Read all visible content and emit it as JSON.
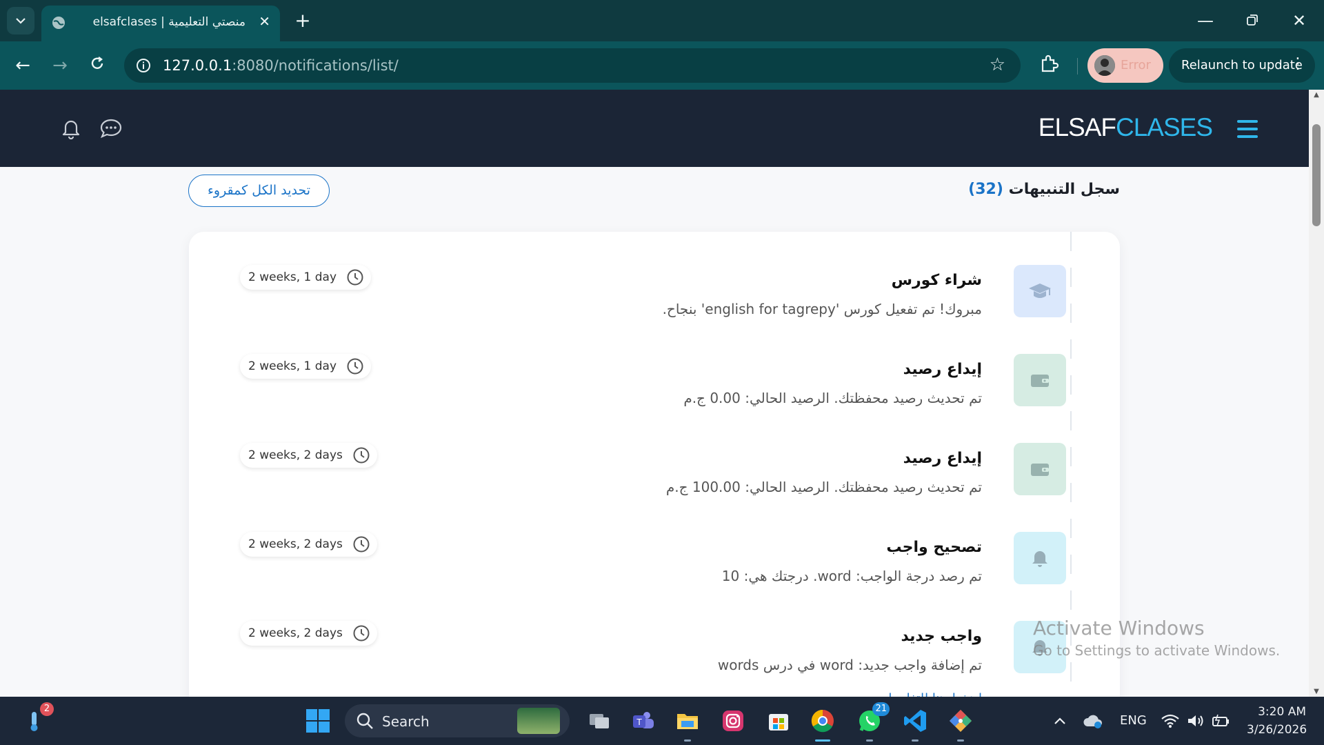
{
  "browser": {
    "tab_title": "elsafclases | منصتي التعليمية",
    "url_host": "127.0.0.1",
    "url_path": ":8080/notifications/list/",
    "profile_status": "Error",
    "relaunch_label": "Relaunch to update"
  },
  "header": {
    "brand_part1": "ELSAF",
    "brand_part2": "CLASES",
    "accent_color": "#2fb6ea"
  },
  "page": {
    "title": "سجل التنبيهات",
    "count": "(32)",
    "mark_all_label": "تحديد الكل كمقروء"
  },
  "notifications": [
    {
      "icon": "graduation-cap-icon",
      "title": "شراء كورس",
      "message": "مبروك! تم تفعيل كورس 'english for tagrepy' بنجاح.",
      "time": "2 weeks, 1 day"
    },
    {
      "icon": "wallet-icon",
      "title": "إيداع رصيد",
      "message": "تم تحديث رصيد محفظتك. الرصيد الحالي: 0.00 ج.م",
      "time": "2 weeks, 1 day"
    },
    {
      "icon": "wallet-icon",
      "title": "إيداع رصيد",
      "message": "تم تحديث رصيد محفظتك. الرصيد الحالي: 100.00 ج.م",
      "time": "2 weeks, 2 days"
    },
    {
      "icon": "bell-icon",
      "title": "تصحيح واجب",
      "message": "تم رصد درجة الواجب: word. درجتك هي: 10",
      "time": "2 weeks, 2 days"
    },
    {
      "icon": "bell-icon",
      "title": "واجب جديد",
      "message": "تم إضافة واجب جديد: word في درس words",
      "time": "2 weeks, 2 days",
      "link": "اضغط هنا للتفاصيل"
    }
  ],
  "watermark": {
    "line1": "Activate Windows",
    "line2": "Go to Settings to activate Windows."
  },
  "taskbar": {
    "search_label": "Search",
    "weather_badge": "2",
    "whatsapp_badge": "21",
    "language": "ENG",
    "time": "3:20 AM",
    "date": "3/26/2026"
  }
}
